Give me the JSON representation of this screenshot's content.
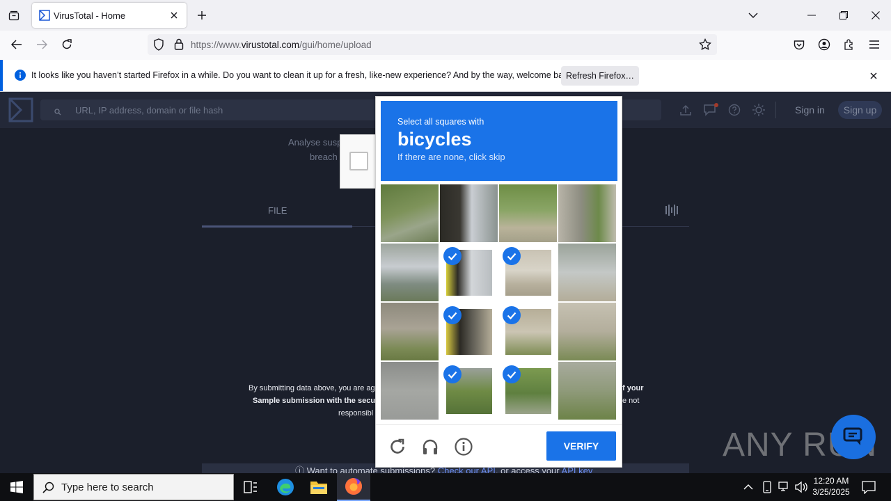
{
  "browser": {
    "tab_title": "VirusTotal - Home",
    "url_prefix": "https://www.",
    "url_domain": "virustotal.com",
    "url_path": "/gui/home/upload",
    "notification_text": "It looks like you haven’t started Firefox in a while. Do you want to clean it up for a fresh, like-new experience? And by the way, welcome back!",
    "refresh_button": "Refresh Firefox…"
  },
  "vt": {
    "search_placeholder": "URL, IP address, domain or file hash",
    "sign_in": "Sign in",
    "sign_up": "Sign up",
    "intro_line1": "Analyse susp",
    "intro_line2": "breach",
    "tab_file": "FILE",
    "terms_left1": "By submitting data above, you are ag",
    "terms_left2": "Sample submission with the secur",
    "terms_left3": "responsibl",
    "terms_right1": "f your",
    "terms_right2": "e not",
    "bottom_text": "Want to automate submissions?",
    "bottom_link1": "Check our API",
    "bottom_mid": ", or access your",
    "bottom_link2": "API key"
  },
  "captcha": {
    "prompt_small": "Select all squares with",
    "prompt_big": "bicycles",
    "prompt_hint": "If there are none, click skip",
    "verify_label": "VERIFY",
    "tiles": [
      {
        "selected": false
      },
      {
        "selected": false
      },
      {
        "selected": false
      },
      {
        "selected": false
      },
      {
        "selected": false
      },
      {
        "selected": true
      },
      {
        "selected": true
      },
      {
        "selected": false
      },
      {
        "selected": false
      },
      {
        "selected": true
      },
      {
        "selected": true
      },
      {
        "selected": false
      },
      {
        "selected": false
      },
      {
        "selected": true
      },
      {
        "selected": true
      },
      {
        "selected": false
      }
    ]
  },
  "watermark": "ANY RUN",
  "taskbar": {
    "search_placeholder": "Type here to search",
    "time": "12:20 AM",
    "date": "3/25/2025"
  },
  "colors": {
    "accent": "#1a73e8",
    "vt_bg": "#1b1f2b",
    "vt_header": "#232838"
  }
}
